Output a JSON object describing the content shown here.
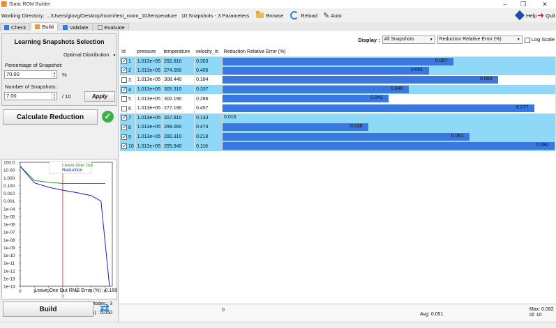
{
  "window": {
    "title": "Static ROM Builder",
    "minimize": "–",
    "maximize": "❐",
    "close": "✕"
  },
  "toolbar": {
    "working_dir_label": "Working Directory:",
    "working_dir_value": ".../Users/giovg/Desktop/room/test_room_10/temperature",
    "snapshots_info": "10 Snapshots - 3 Parameters",
    "browse": "Browse",
    "reload": "Reload",
    "auto": "Auto",
    "help": "Help",
    "quit": "Quit"
  },
  "tabs": [
    {
      "label": "Check",
      "color": "#3a78e0"
    },
    {
      "label": "Build",
      "color": "#e0a030"
    },
    {
      "label": "Validate",
      "color": "#3a78e0"
    },
    {
      "label": "Evaluate",
      "color": "#888888"
    }
  ],
  "left": {
    "group_title": "Learning Snapshots Selection",
    "distribution": "Optimal Distribution",
    "pct_label": "Percentage of Snapshot:",
    "pct_value": "70.00",
    "pct_unit": "%",
    "num_label": "Number of Snapshots :",
    "num_value": "7.00",
    "num_total": "/ 10",
    "apply": "Apply",
    "calculate": "Calculate Reduction",
    "check": "✓",
    "num_modes": "Number of Modes : 3",
    "rms_error": "Reduction RMS Error (%) : 0.050",
    "loo_error": "Leave One Out RMS Error (%) : 0.168",
    "build": "Build",
    "swap": "⇄"
  },
  "plot": {
    "legend": [
      "Leave One Out",
      "Reduction"
    ],
    "series_colors": [
      "#2a9a2a",
      "#1a1ad8"
    ],
    "y_ticks": [
      "100.0",
      "10.00",
      "1.000",
      "0.100",
      "0.010",
      "0.001",
      "1e-04",
      "1e-05",
      "1e-06",
      "1e-07",
      "1e-08",
      "1e-09",
      "1e-10",
      "1e-11",
      "1e-12",
      "1e-13",
      "1e-14"
    ],
    "x_ticks": [
      "0",
      "1",
      "2",
      "3",
      "4",
      "5",
      "6"
    ],
    "marker_label": "3",
    "marker_x": 3,
    "loo_values": [
      30,
      0.45,
      0.26,
      0.18,
      0.18,
      0.18,
      0.18
    ],
    "reduction_values": [
      30,
      0.22,
      0.06,
      0.025,
      0.012,
      0.005,
      0.001,
      1e-14
    ],
    "reduction_x": [
      0,
      1,
      2,
      3,
      4,
      5,
      5.7,
      6.3
    ]
  },
  "display": {
    "label": "Display :",
    "mode": "All Snapshots",
    "metric": "Reduction Relative Error (%)",
    "log_scale": "Log Scale"
  },
  "table": {
    "headers": [
      "Id",
      "pressure",
      "temperature",
      "velocity_in",
      "Reduction Relative Error (%)"
    ],
    "max_error": 0.082,
    "rows": [
      {
        "id": "1",
        "checked": true,
        "pressure": "1.013e+05",
        "temperature": "292.810",
        "velocity": "0.303",
        "error": 0.057,
        "error_label": "0.057"
      },
      {
        "id": "2",
        "checked": true,
        "pressure": "1.013e+05",
        "temperature": "274.060",
        "velocity": "0.406",
        "error": 0.051,
        "error_label": "0.051"
      },
      {
        "id": "3",
        "checked": false,
        "pressure": "1.013e+05",
        "temperature": "308.440",
        "velocity": "0.184",
        "error": 0.068,
        "error_label": "0.068"
      },
      {
        "id": "4",
        "checked": true,
        "pressure": "1.013e+05",
        "temperature": "305.310",
        "velocity": "0.337",
        "error": 0.046,
        "error_label": "0.046"
      },
      {
        "id": "5",
        "checked": false,
        "pressure": "1.013e+05",
        "temperature": "302.190",
        "velocity": "0.286",
        "error": 0.041,
        "error_label": "0.041"
      },
      {
        "id": "6",
        "checked": false,
        "pressure": "1.013e+05",
        "temperature": "277.190",
        "velocity": "0.457",
        "error": 0.077,
        "error_label": "0.077"
      },
      {
        "id": "7",
        "checked": true,
        "pressure": "1.013e+05",
        "temperature": "317.810",
        "velocity": "0.133",
        "error": 0.016,
        "error_label": "0.016"
      },
      {
        "id": "8",
        "checked": true,
        "pressure": "1.013e+05",
        "temperature": "299.060",
        "velocity": "0.474",
        "error": 0.036,
        "error_label": "0.036"
      },
      {
        "id": "9",
        "checked": true,
        "pressure": "1.013e+05",
        "temperature": "280.310",
        "velocity": "0.218",
        "error": 0.061,
        "error_label": "0.061"
      },
      {
        "id": "10",
        "checked": true,
        "pressure": "1.013e+05",
        "temperature": "295.940",
        "velocity": "0.116",
        "error": 0.082,
        "error_label": "0.082"
      }
    ]
  },
  "footer": {
    "zero": "0",
    "avg": "Avg: 0.051",
    "max": "Max: 0.082",
    "max_id": "Id: 10",
    "avg_value": 0.051
  }
}
